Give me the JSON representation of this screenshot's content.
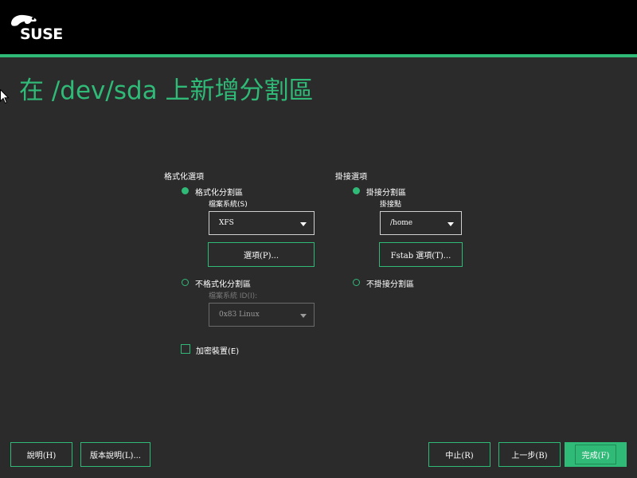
{
  "brand": {
    "logo_text": "SUSE",
    "accent": "#30ba78"
  },
  "title": "在 /dev/sda 上新增分割區",
  "format": {
    "section_label": "格式化選項",
    "format_option": "格式化分割區",
    "filesystem_label": "檔案系統(S)",
    "filesystem_value": "XFS",
    "options_button": "選項(P)...",
    "no_format_option": "不格式化分割區",
    "fs_id_label": "檔案系統 ID(I):",
    "fs_id_value": "0x83 Linux",
    "encrypt_label": "加密裝置(E)"
  },
  "mount": {
    "section_label": "掛接選項",
    "mount_option": "掛接分割區",
    "mount_point_label": "掛接點",
    "mount_point_value": "/home",
    "fstab_button": "Fstab 選項(T)...",
    "no_mount_option": "不掛接分割區"
  },
  "footer": {
    "help": "說明(H)",
    "release_notes": "版本說明(L)...",
    "abort": "中止(R)",
    "back": "上一步(B)",
    "finish": "完成(F)"
  },
  "state": {
    "format_selected": true,
    "mount_selected": true,
    "encrypt_checked": false
  }
}
